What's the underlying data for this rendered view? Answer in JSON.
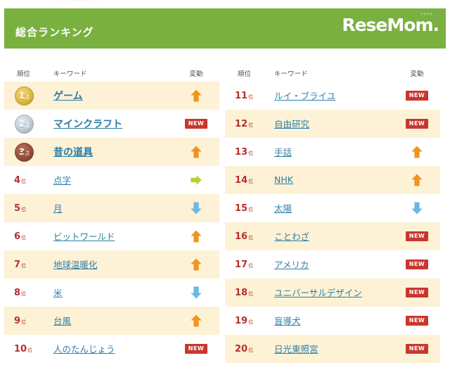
{
  "header": {
    "title": "総合ランキング",
    "brand_sup": "リセマム",
    "brand": "ReseMom.",
    "bar_color": "#79b03f"
  },
  "table": {
    "columns": {
      "rank": "順位",
      "keyword": "キーワード",
      "change": "変動"
    },
    "rank_suffix": "位",
    "new_label": "NEW",
    "colors": {
      "row_alt": "#fdf2d6",
      "rank_text": "#b5312a",
      "link": "#2f7fa8",
      "arrow_up": "#f0941e",
      "arrow_down": "#6cb8e0",
      "arrow_flat": "#b5d334",
      "badge_new": "#c8372d",
      "medal_gold": "#d9b747",
      "medal_silver": "#b6c0c9",
      "medal_bronze": "#8d4a36"
    }
  },
  "left_column": [
    {
      "rank": "1",
      "suffix": "位",
      "keyword": "ゲーム",
      "change": "up",
      "medal": "gold",
      "shaded": true
    },
    {
      "rank": "2",
      "suffix": "位",
      "keyword": "マインクラフト",
      "change": "new",
      "medal": "silver",
      "shaded": false
    },
    {
      "rank": "3",
      "suffix": "位",
      "keyword": "昔の道具",
      "change": "up",
      "medal": "bronze",
      "shaded": true
    },
    {
      "rank": "4",
      "suffix": "位",
      "keyword": "点字",
      "change": "flat",
      "medal": "",
      "shaded": false
    },
    {
      "rank": "5",
      "suffix": "位",
      "keyword": "月",
      "change": "down",
      "medal": "",
      "shaded": true
    },
    {
      "rank": "6",
      "suffix": "位",
      "keyword": "ビットワールド",
      "change": "up",
      "medal": "",
      "shaded": false
    },
    {
      "rank": "7",
      "suffix": "位",
      "keyword": "地球温暖化",
      "change": "up",
      "medal": "",
      "shaded": true
    },
    {
      "rank": "8",
      "suffix": "位",
      "keyword": "米",
      "change": "down",
      "medal": "",
      "shaded": false
    },
    {
      "rank": "9",
      "suffix": "位",
      "keyword": "台風",
      "change": "up",
      "medal": "",
      "shaded": true
    },
    {
      "rank": "10",
      "suffix": "位",
      "keyword": "人のたんじょう",
      "change": "new",
      "medal": "",
      "shaded": false
    }
  ],
  "right_column": [
    {
      "rank": "11",
      "suffix": "位",
      "keyword": "ルイ・ブライユ",
      "change": "new",
      "medal": "",
      "shaded": false
    },
    {
      "rank": "12",
      "suffix": "位",
      "keyword": "自由研究",
      "change": "new",
      "medal": "",
      "shaded": true
    },
    {
      "rank": "13",
      "suffix": "位",
      "keyword": "手話",
      "change": "up",
      "medal": "",
      "shaded": false
    },
    {
      "rank": "14",
      "suffix": "位",
      "keyword": "NHK",
      "change": "up",
      "medal": "",
      "shaded": true
    },
    {
      "rank": "15",
      "suffix": "位",
      "keyword": "太陽",
      "change": "down",
      "medal": "",
      "shaded": false
    },
    {
      "rank": "16",
      "suffix": "位",
      "keyword": "ことわざ",
      "change": "new",
      "medal": "",
      "shaded": true
    },
    {
      "rank": "17",
      "suffix": "位",
      "keyword": "アメリカ",
      "change": "new",
      "medal": "",
      "shaded": false
    },
    {
      "rank": "18",
      "suffix": "位",
      "keyword": "ユニバーサルデザイン",
      "change": "new",
      "medal": "",
      "shaded": true
    },
    {
      "rank": "19",
      "suffix": "位",
      "keyword": "盲導犬",
      "change": "new",
      "medal": "",
      "shaded": false
    },
    {
      "rank": "20",
      "suffix": "位",
      "keyword": "日光東照宮",
      "change": "new",
      "medal": "",
      "shaded": true
    }
  ]
}
